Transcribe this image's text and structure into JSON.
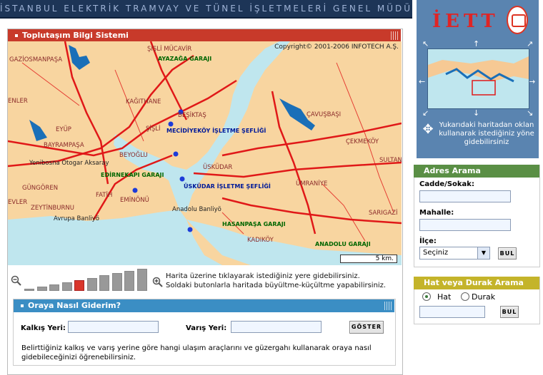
{
  "header": {
    "banner": "İSTANBUL ELEKTRİK TRAMVAY VE TÜNEL İŞLETMELERİ GENEL MÜDÜRLÜĞÜ"
  },
  "main": {
    "title": "Toplutaşım Bilgi Sistemi",
    "copyright": "Copyright© 2001-2006 INFOTECH A.Ş.",
    "scale": "5 km.",
    "map_labels": [
      "ŞİŞLİ MÜCAVİR",
      "GAZİOSMANPAŞA",
      "KAĞITHANE",
      "BEŞİKTAŞ",
      "ŞİŞLİ",
      "ÇAVUŞBAŞI",
      "EYÜP",
      "BAYRAMPAŞA",
      "ÇEKMEKÖY",
      "BEYOĞLU",
      "SULTAN",
      "ÜSKÜDAR",
      "GÜNGÖREN",
      "FATİH",
      "ÜMRANİYE",
      "EMİNÖNÜ",
      "ZEYTİNBURNU",
      "SARIGAZİ",
      "KADIKÖY",
      "EVLER",
      "ENLER"
    ],
    "stops": [
      "MECİDİYEKÖY İŞLETME ŞEFLİĞİ",
      "ÜSKÜDAR İŞLETME ŞEFLİĞİ"
    ],
    "garages": [
      "AYAZAĞA GARAJI",
      "EDİRNEKAPI GARAJI",
      "HASANPAŞA GARAJI",
      "ANADOLU GARAJI"
    ],
    "places": [
      "Yenibosna Otogar Aksaray",
      "Anadolu Banliyö",
      "Avrupa Banliyö"
    ],
    "zoom_level": 5,
    "zoom_steps": 10,
    "hint_line1": "Harita üzerine tıklayarak istediğiniz yere gidebilirsiniz.",
    "hint_line2": "Soldaki butonlarla haritada büyültme-küçültme yapabilirsiniz."
  },
  "route": {
    "title": "Oraya Nasıl Giderim?",
    "from_label": "Kalkış Yeri:",
    "to_label": "Varış Yeri:",
    "from_value": "",
    "to_value": "",
    "button": "GÖSTER",
    "desc": "Belirttiğiniz kalkış ve varış yerine göre hangi ulaşım araçlarını ve güzergahı kullanarak oraya nasıl gidebileceğinizi öğrenebilirsiniz."
  },
  "side": {
    "logo": "İETT",
    "nav_text": "Yukarıdaki haritadan oklan kullanarak istediğiniz yöne gidebilirsiniz",
    "address": {
      "title": "Adres Arama",
      "street_label": "Cadde/Sokak:",
      "street_value": "",
      "quarter_label": "Mahalle:",
      "quarter_value": "",
      "district_label": "İlçe:",
      "district_selected": "Seçiniz",
      "button": "BUL"
    },
    "line": {
      "title": "Hat veya Durak Arama",
      "opt1": "Hat",
      "opt2": "Durak",
      "selected": "Hat",
      "value": "",
      "button": "BUL"
    }
  },
  "colors": {
    "red": "#c83a2a",
    "blue": "#3b8ec4",
    "green": "#5a8f45",
    "yellow": "#c4b42a",
    "water": "#bfe6ee",
    "land": "#f8d5a0"
  }
}
